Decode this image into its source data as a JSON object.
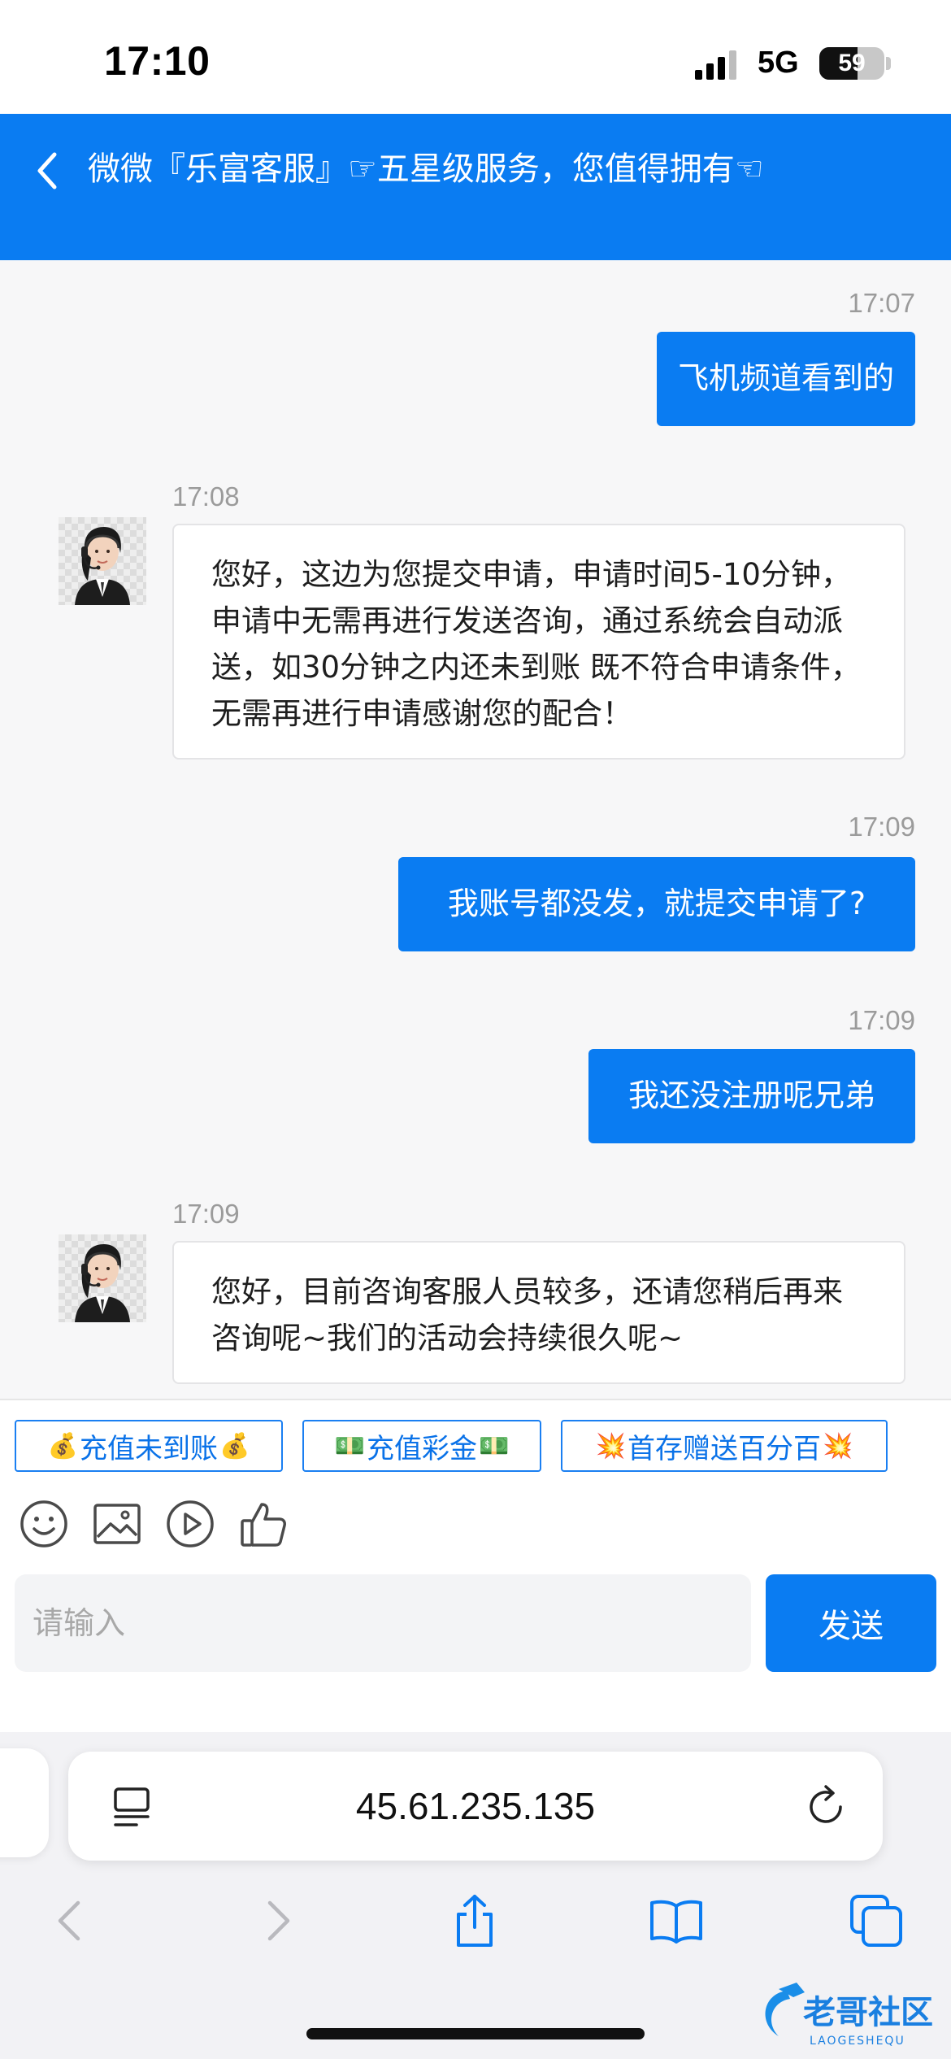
{
  "status_bar": {
    "time": "17:10",
    "network": "5G",
    "battery_level": "59",
    "battery_fraction": 0.59
  },
  "header": {
    "title": "微微『乐富客服』☞五星级服务，您值得拥有☜",
    "accent_color": "#0a7cf2"
  },
  "messages": [
    {
      "from": "user",
      "time": "17:07",
      "text": "飞机频道看到的"
    },
    {
      "from": "agent",
      "time": "17:08",
      "text": "您好，这边为您提交申请，申请时间5-10分钟，申请中无需再进行发送咨询，通过系统会自动派送，如30分钟之内还未到账 既不符合申请条件，无需再进行申请感谢您的配合！"
    },
    {
      "from": "user",
      "time": "17:09",
      "text": "我账号都没发，就提交申请了?"
    },
    {
      "from": "user",
      "time": "17:09",
      "text": "我还没注册呢兄弟"
    },
    {
      "from": "agent",
      "time": "17:09",
      "text": "您好，目前咨询客服人员较多，还请您稍后再来咨询呢~我们的活动会持续很久呢~"
    }
  ],
  "quick_replies": [
    {
      "label": "充值未到账",
      "emoji": "💰"
    },
    {
      "label": "充值彩金",
      "emoji": "💵"
    },
    {
      "label": "首存赠送百分百",
      "emoji": "💥"
    }
  ],
  "toolbar_icons": [
    "emoji-icon",
    "image-icon",
    "video-icon",
    "thumbs-up-icon"
  ],
  "input": {
    "placeholder": "请输入",
    "value": ""
  },
  "send_label": "发送",
  "browser": {
    "url": "45.61.235.135"
  },
  "watermark": {
    "text": "老哥社区",
    "subtext": "LAOGESHEQU"
  }
}
